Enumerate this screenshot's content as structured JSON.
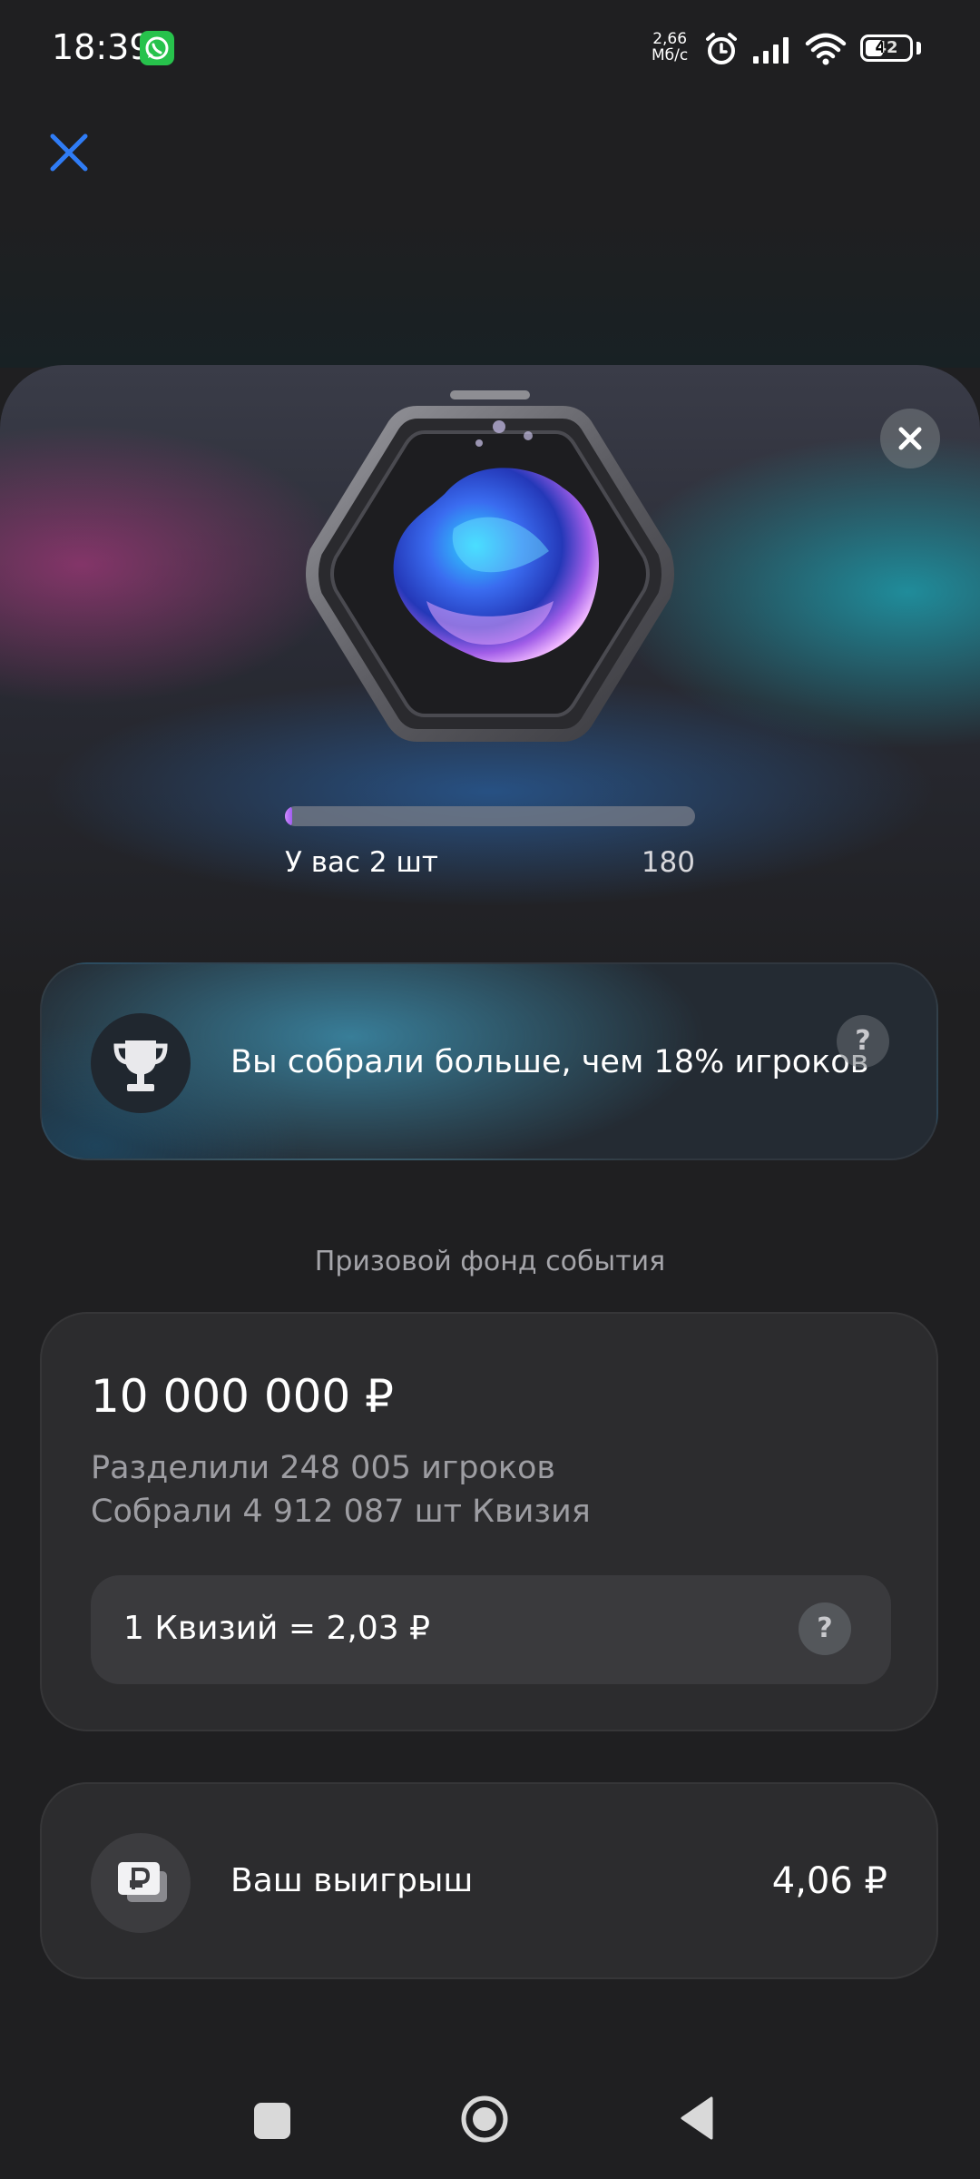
{
  "status_bar": {
    "time": "18:39",
    "net_speed_value": "2,66",
    "net_speed_unit": "Мб/с",
    "battery": "42",
    "icons": [
      "whatsapp-icon",
      "alarm-icon",
      "signal-icon",
      "wifi-icon",
      "battery-icon"
    ]
  },
  "header": {
    "close_icon": "close-icon",
    "accent_color": "#2f7cf6"
  },
  "collection": {
    "item_image": "quizium-gem",
    "count_label": "У вас 2 шт",
    "target": "180",
    "progress_fraction": 0.011
  },
  "rank": {
    "icon": "trophy-icon",
    "text": "Вы собрали больше, чем 18% игроков",
    "help": "?"
  },
  "prize_fund": {
    "section_title": "Призовой фонд события",
    "amount": "10 000 000 ₽",
    "shared_by": "Разделили 248 005 игроков",
    "collected": "Собрали 4 912 087 шт Квизия",
    "rate": "1 Квизий = 2,03 ₽",
    "help": "?"
  },
  "winnings": {
    "icon": "ruble-cards-icon",
    "label": "Ваш выигрыш",
    "amount": "4,06 ₽"
  },
  "nav_bar": {
    "buttons": [
      "recents-button",
      "home-button",
      "back-button"
    ]
  }
}
